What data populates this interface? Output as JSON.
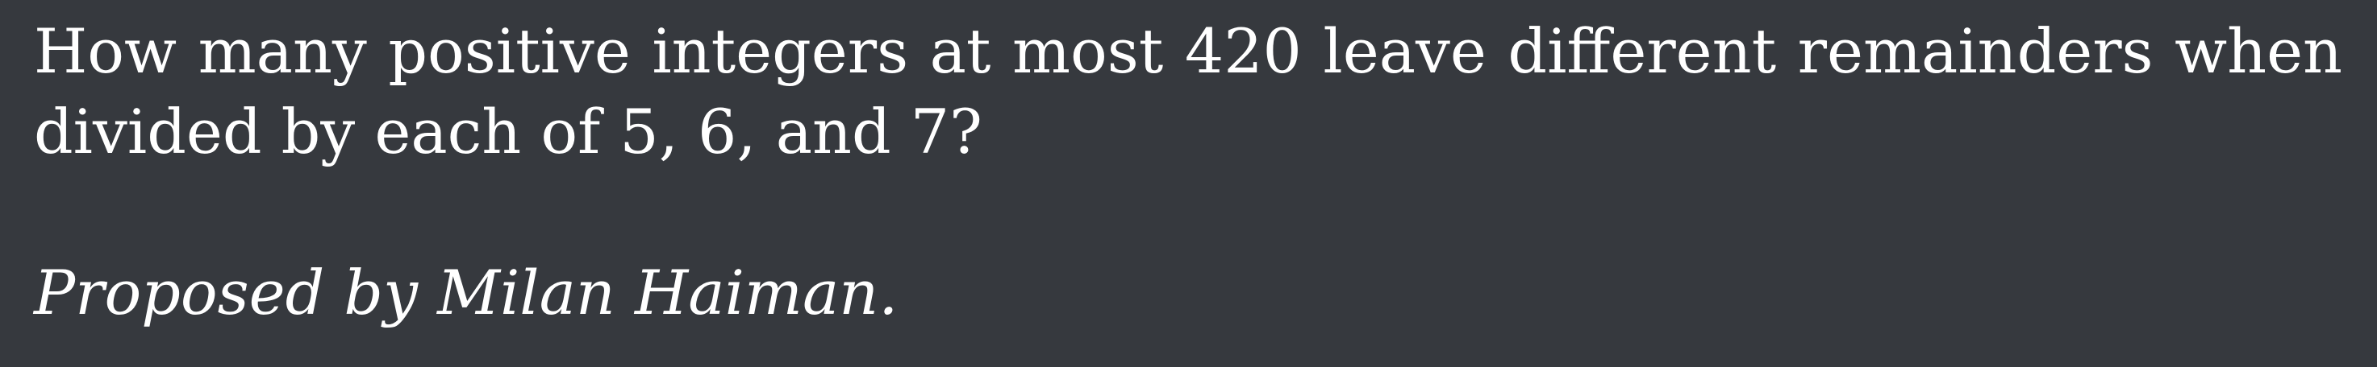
{
  "problem": {
    "text": "How many positive integers at most 420 leave different remainders when divided by each of 5, 6, and 7?",
    "attribution": "Proposed by Milan Haiman."
  },
  "colors": {
    "background": "#36393e",
    "text": "#ffffff"
  }
}
